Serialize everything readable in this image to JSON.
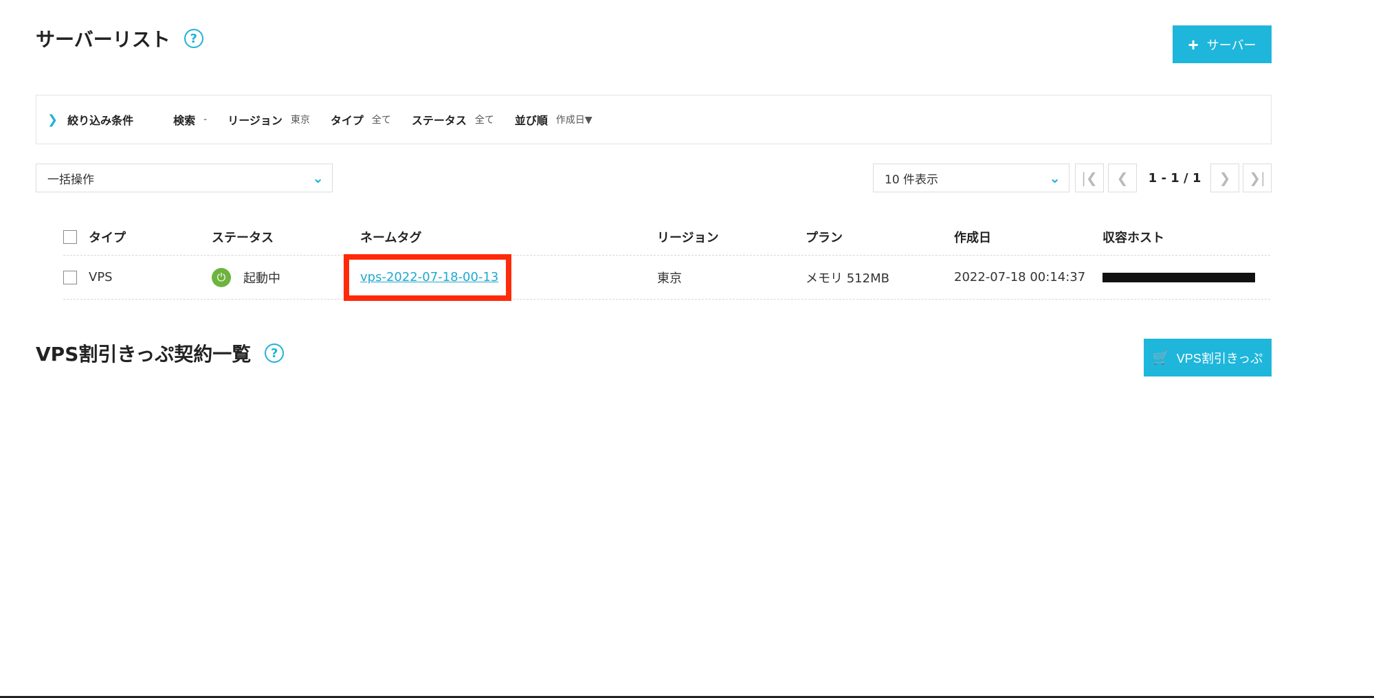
{
  "header": {
    "title": "サーバーリスト",
    "help_glyph": "?",
    "add_button_label": "サーバー"
  },
  "filter": {
    "title": "絞り込み条件",
    "search_label": "検索",
    "search_value": "-",
    "region_label": "リージョン",
    "region_value": "東京",
    "type_label": "タイプ",
    "type_value": "全て",
    "status_label": "ステータス",
    "status_value": "全て",
    "sort_label": "並び順",
    "sort_value": "作成日▼"
  },
  "controls": {
    "bulk_action": "一括操作",
    "per_page": "10 件表示",
    "page_count": "1 - 1 / 1"
  },
  "table": {
    "columns": [
      "タイプ",
      "ステータス",
      "ネームタグ",
      "リージョン",
      "プラン",
      "作成日",
      "収容ホスト"
    ],
    "rows": [
      {
        "type": "VPS",
        "status": "起動中",
        "name_tag": "vps-2022-07-18-00-13",
        "region": "東京",
        "plan": "メモリ 512MB",
        "created": "2022-07-18 00:14:37"
      }
    ]
  },
  "section2": {
    "title": "VPS割引きっぷ契約一覧",
    "help_glyph": "?",
    "button_label": "VPS割引きっぷ"
  },
  "colors": {
    "accent": "#1fb6db",
    "status_running": "#6db33f",
    "highlight": "#ff2a0a"
  }
}
